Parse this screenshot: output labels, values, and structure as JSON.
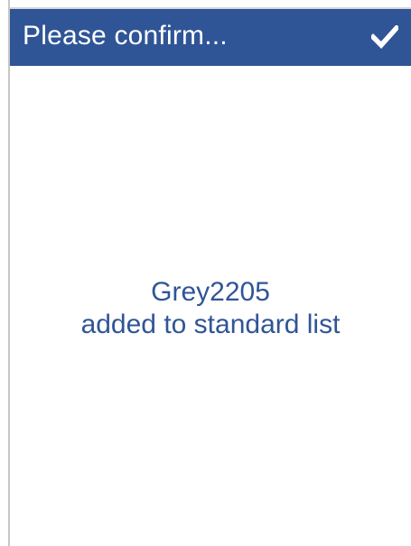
{
  "dialog": {
    "title": "Please confirm...",
    "confirm_icon": "checkmark-icon",
    "message_line_1": "Grey2205",
    "message_line_2": "added to standard list"
  },
  "colors": {
    "header_background": "#2f5597",
    "header_text": "#ffffff",
    "message_text": "#2f5597",
    "background": "#ffffff"
  }
}
